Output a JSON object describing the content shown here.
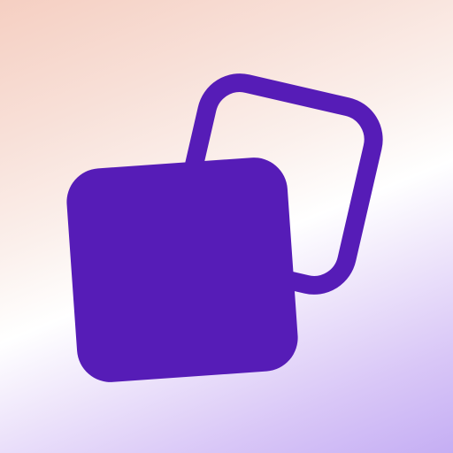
{
  "app_icon": {
    "name": "two-overlapping-squares-icon",
    "colors": {
      "shape": "#561cb7",
      "background_top_left": "#f5cfc2",
      "background_middle": "#ffffff",
      "background_bottom_right": "#c5aef4"
    }
  }
}
